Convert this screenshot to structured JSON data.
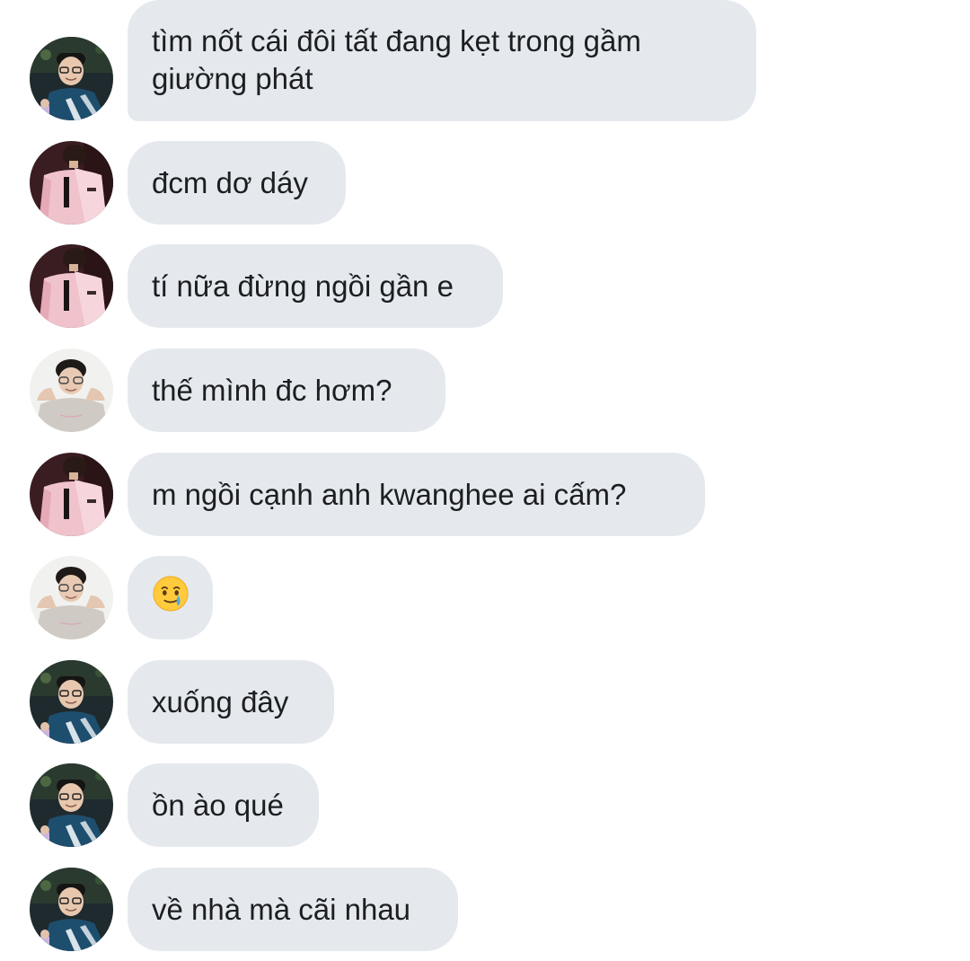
{
  "conversation": {
    "messages": [
      {
        "text": "tìm nốt cái đôi tất đang kẹt trong gầm giường phát",
        "avatar": "avatar-dark-jacket-icon"
      },
      {
        "text": "đcm dơ dáy",
        "avatar": "avatar-pink-jacket-icon"
      },
      {
        "text": "tí nữa đừng ngồi gần e",
        "avatar": "avatar-pink-jacket-icon"
      },
      {
        "text": "thế mình đc hơm?",
        "avatar": "avatar-gray-hoodie-icon"
      },
      {
        "text": "m ngồi cạnh anh kwanghee ai cấm?",
        "avatar": "avatar-pink-jacket-icon"
      },
      {
        "text": "",
        "emoji": "face-holding-back-tears-icon",
        "avatar": "avatar-gray-hoodie-icon"
      },
      {
        "text": "xuống đây",
        "avatar": "avatar-dark-jacket-icon"
      },
      {
        "text": "ồn ào qué",
        "avatar": "avatar-dark-jacket-icon"
      },
      {
        "text": "về nhà mà cãi nhau",
        "avatar": "avatar-dark-jacket-icon"
      }
    ]
  },
  "colors": {
    "bubble_bg": "#e5e9ee",
    "text": "#1c1e21",
    "background": "#ffffff"
  }
}
